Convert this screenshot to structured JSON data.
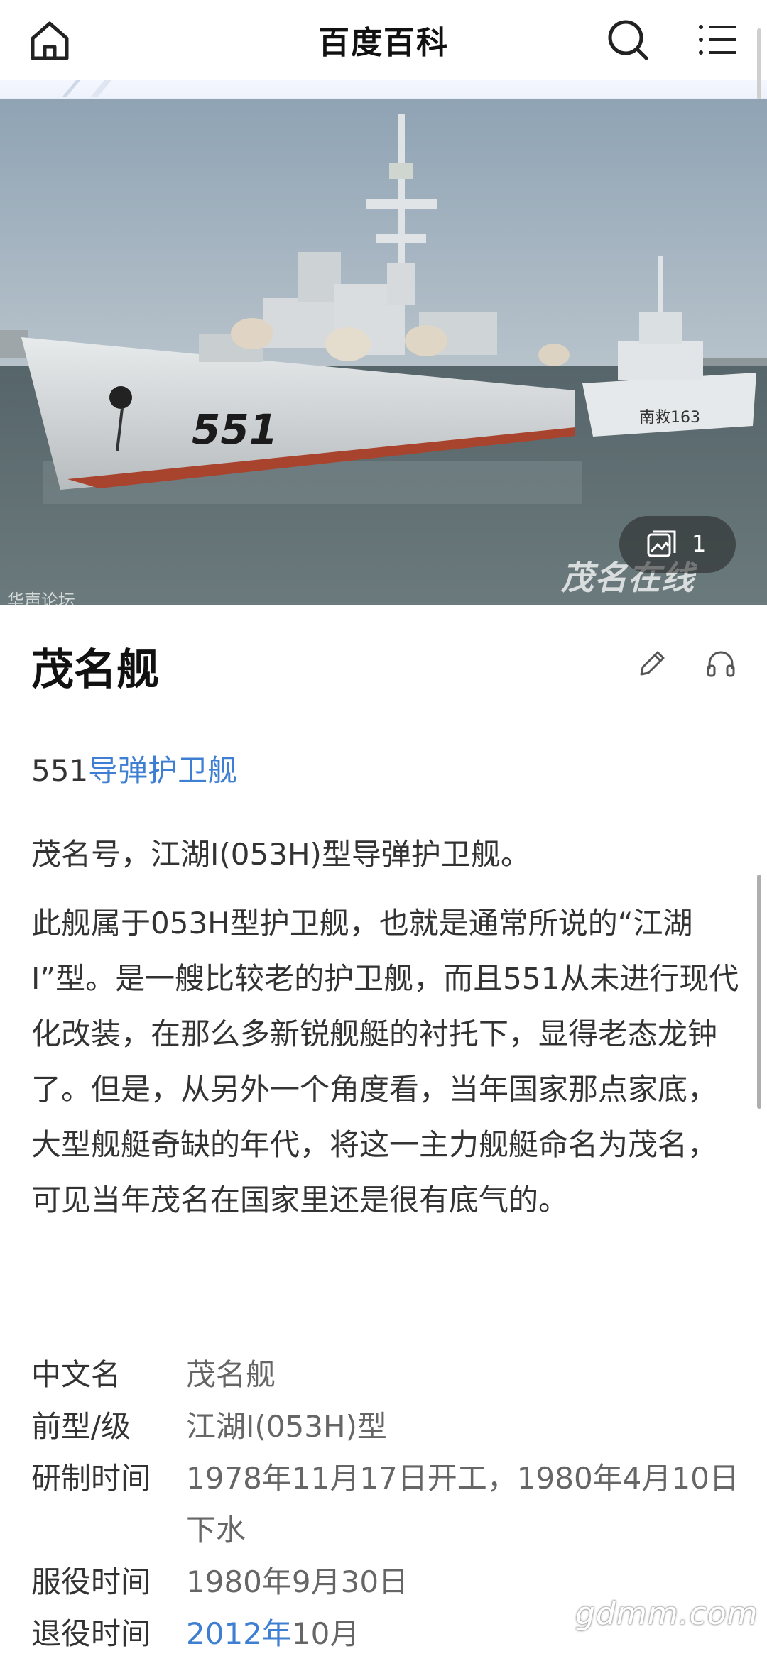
{
  "app": {
    "title": "百度百科"
  },
  "hero": {
    "photo_count": "1",
    "photo_watermark": "茂名在线",
    "photo_corner_text": "华声论坛"
  },
  "entry": {
    "title": "茂名舰",
    "subtitle_prefix": "551",
    "subtitle_link": "导弹护卫舰",
    "summary": "茂名号，江湖I(053H)型导弹护卫舰。",
    "paragraph": "此舰属于053H型护卫舰，也就是通常所说的“江湖I”型。是一艘比较老的护卫舰，而且551从未进行现代化改装，在那么多新锐舰艇的衬托下，显得老态龙钟了。但是，从另外一个角度看，当年国家那点家底，大型舰艇奇缺的年代，将这一主力舰艇命名为茂名，可见当年茂名在国家里还是很有底气的。"
  },
  "info": [
    {
      "key": "中文名",
      "value": "茂名舰"
    },
    {
      "key": "前型/级",
      "value": "江湖I(053H)型"
    },
    {
      "key": "研制时间",
      "value": "1978年11月17日开工，1980年4月10日下水"
    },
    {
      "key": "服役时间",
      "value": "1980年9月30日"
    },
    {
      "key": "退役时间",
      "value_link": "2012年",
      "value_rest": "10月"
    }
  ],
  "site_watermark": "gdmm.com",
  "colors": {
    "link": "#3f7fd3",
    "text": "#333333",
    "title": "#111111"
  }
}
